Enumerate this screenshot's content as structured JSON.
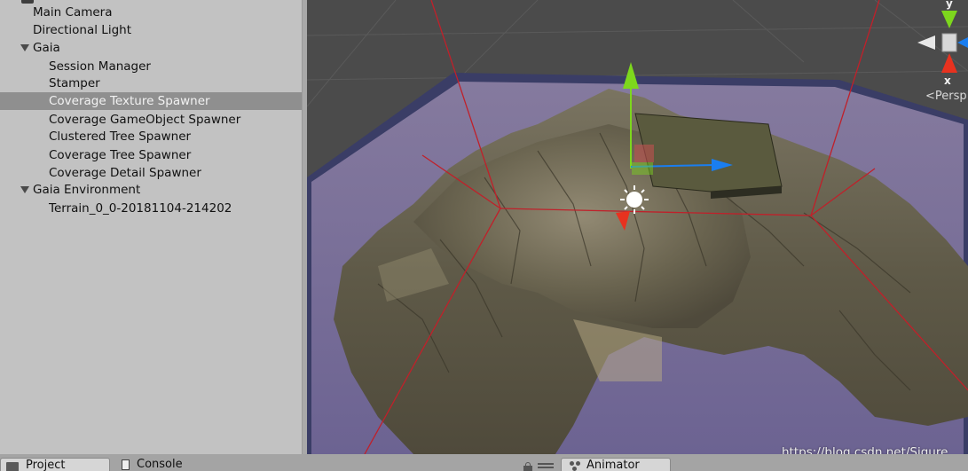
{
  "hierarchy": {
    "items": [
      {
        "label": "Main Camera",
        "expanded": null,
        "selected": false
      },
      {
        "label": "Directional Light",
        "expanded": null,
        "selected": false
      },
      {
        "label": "Gaia",
        "expanded": true,
        "selected": false
      },
      {
        "label": "Session Manager",
        "expanded": null,
        "selected": false
      },
      {
        "label": "Stamper",
        "expanded": null,
        "selected": false
      },
      {
        "label": "Coverage Texture Spawner",
        "expanded": null,
        "selected": true
      },
      {
        "label": "Coverage GameObject Spawner",
        "expanded": null,
        "selected": false
      },
      {
        "label": "Clustered Tree Spawner",
        "expanded": null,
        "selected": false
      },
      {
        "label": "Coverage Tree Spawner",
        "expanded": null,
        "selected": false
      },
      {
        "label": "Coverage Detail Spawner",
        "expanded": null,
        "selected": false
      },
      {
        "label": "Gaia Environment",
        "expanded": true,
        "selected": false
      },
      {
        "label": "Terrain_0_0-20181104-214202",
        "expanded": null,
        "selected": false
      }
    ]
  },
  "scene": {
    "gizmo": {
      "y_label": "y",
      "x_label": "x",
      "projection_label": "<Persp"
    },
    "colors": {
      "background": "#4a4a4a",
      "bounds_lines": "#c0202a",
      "terrain_base": "#6a6450",
      "water": "#7e6f9a",
      "handle_y": "#7dd71d",
      "handle_x": "#1a7ef0",
      "handle_z": "#e8321f"
    },
    "watermark": "https://blog.csdn.net/Sigure_"
  },
  "bottom_tabs": {
    "project": "Project",
    "console": "Console",
    "animator": "Animator"
  }
}
